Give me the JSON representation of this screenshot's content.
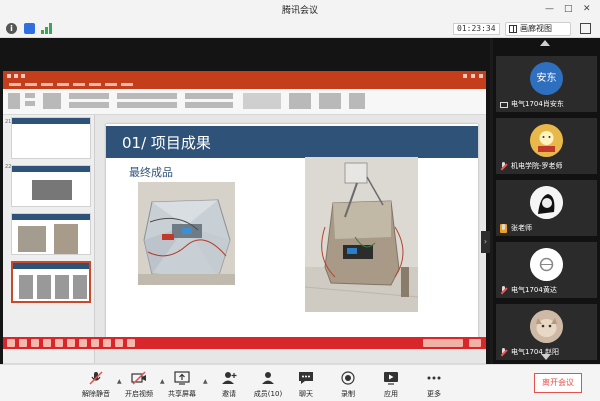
{
  "window": {
    "title": "腾讯会议"
  },
  "status": {
    "info_icon": "info-icon",
    "shield_icon": "shield-icon",
    "signal_icon": "signal-icon",
    "timer": "01:23:34",
    "view_label": "画廊视图",
    "fullscreen_icon": "fullscreen-icon"
  },
  "slide": {
    "title": "01/ 项目成果",
    "subtitle": "最终成品",
    "header_color": "#2e5278"
  },
  "participants": [
    {
      "avatar_text": "安东",
      "avatar_color": "#2f6fc0",
      "name": "电气1704肖安东",
      "status_icon": "monitor-icon"
    },
    {
      "avatar_text": "",
      "avatar_color": "#d9a63a",
      "name": "机电学院-罗老师",
      "status_icon": "mic-muted-icon"
    },
    {
      "avatar_text": "",
      "avatar_color": "#f5f5f5",
      "name": "张老师",
      "status_icon": "mic-icon"
    },
    {
      "avatar_text": "",
      "avatar_color": "#ffffff",
      "name": "电气1704黄达",
      "status_icon": "mic-muted-icon"
    },
    {
      "avatar_text": "",
      "avatar_color": "#c9b7a8",
      "name": "电气1704 赵阳",
      "status_icon": "mic-muted-icon"
    }
  ],
  "toolbar": {
    "buttons": [
      {
        "label": "解除静音",
        "icon": "mic-muted-icon"
      },
      {
        "label": "开启视频",
        "icon": "camera-off-icon"
      },
      {
        "label": "共享屏幕",
        "icon": "share-screen-icon"
      },
      {
        "label": "邀请",
        "icon": "invite-icon"
      },
      {
        "label": "成员(10)",
        "icon": "members-icon"
      },
      {
        "label": "聊天",
        "icon": "chat-icon"
      },
      {
        "label": "录制",
        "icon": "record-icon"
      },
      {
        "label": "应用",
        "icon": "apps-icon"
      },
      {
        "label": "更多",
        "icon": "more-icon"
      }
    ],
    "end_label": "离开会议",
    "end_color": "#e8504b"
  }
}
